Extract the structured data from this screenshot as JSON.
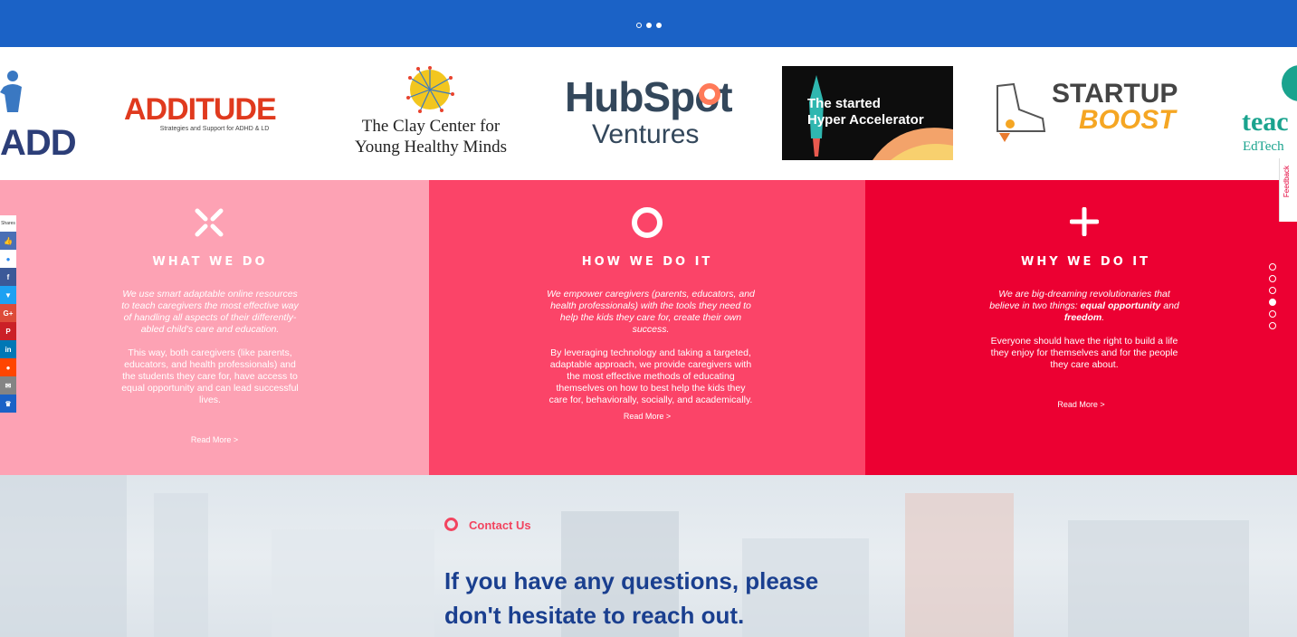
{
  "top_slider": {
    "dot_count": 3,
    "active_dot": 0
  },
  "logos": {
    "add_text": "ADD",
    "additude_title": "ADDITUDE",
    "additude_tagline": "Strategies and Support for ADHD & LD",
    "clay_line1": "The Clay Center for",
    "clay_line2": "Young Healthy Minds",
    "hubspot_line1": "HubSpot",
    "hubspot_line2": "Ventures",
    "started_line1": "The started",
    "started_line2": "Hyper Accelerator",
    "startup_line1": "STARTUP",
    "startup_line2": "BOOST",
    "teach_line1": "teac",
    "teach_line2": "EdTech"
  },
  "columns": [
    {
      "heading": "WHAT WE DO",
      "p1": "We use smart adaptable online resources to teach caregivers the most effective way of handling all aspects of their differently-abled child's care and education.",
      "p2": "This way, both caregivers (like parents, educators, and health professionals) and the students they care for, have access to equal opportunity and can lead successful lives.",
      "read_more": "Read More >",
      "color": "#fda2b4"
    },
    {
      "heading": "HOW WE DO IT",
      "p1": "We empower caregivers (parents, educators, and health professionals) with the tools they need to help the kids they care for, create their own success.",
      "p2": "By leveraging technology and taking a targeted, adaptable approach, we provide caregivers with the most effective methods of educating themselves on how to best help the kids they care for, behaviorally, socially, and academically.",
      "read_more": "Read More >",
      "color": "#fb4468"
    },
    {
      "heading": "WHY WE DO IT",
      "p1_a": "We are big-dreaming revolutionaries that believe in two things: ",
      "p1_b": "equal opportunity",
      "p1_c": " and ",
      "p1_d": "freedom",
      "p1_e": ".",
      "p2": "Everyone should have the right to build a life they enjoy for themselves and for the people they care about.",
      "read_more": "Read More >",
      "color": "#ec0032"
    }
  ],
  "contact": {
    "label": "Contact Us",
    "heading": "If you have any questions, please don't hesitate to reach out."
  },
  "share_bar": {
    "label": "Shares",
    "buttons": [
      {
        "icon": "like-icon",
        "color": "#4a6fb5"
      },
      {
        "icon": "messenger-icon",
        "color": "#2a8bf2"
      },
      {
        "icon": "facebook-icon",
        "color": "#3b5998"
      },
      {
        "icon": "twitter-icon",
        "color": "#1da1f2"
      },
      {
        "icon": "google-plus-icon",
        "color": "#dd4b39"
      },
      {
        "icon": "pinterest-icon",
        "color": "#cb2027"
      },
      {
        "icon": "linkedin-icon",
        "color": "#0077b5"
      },
      {
        "icon": "reddit-icon",
        "color": "#ff4500"
      },
      {
        "icon": "email-icon",
        "color": "#848484"
      },
      {
        "icon": "crown-icon",
        "color": "#1b62c6"
      }
    ]
  },
  "feedback": {
    "label": "Feedback"
  },
  "side_nav": {
    "dot_count": 6,
    "active_index": 3
  }
}
